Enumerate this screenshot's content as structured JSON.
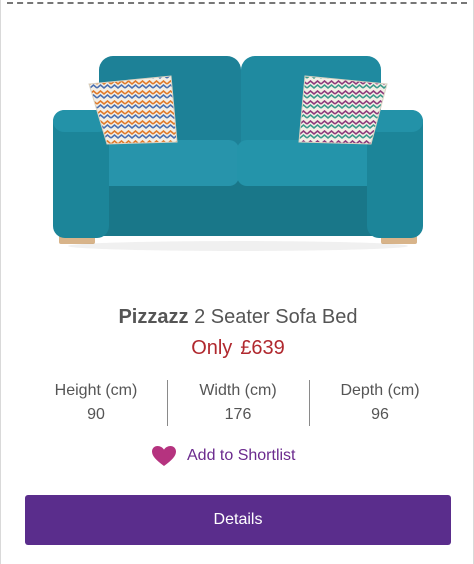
{
  "product": {
    "brand": "Pizzazz",
    "name": "2 Seater Sofa Bed",
    "price_prefix": "Only",
    "price": "£639"
  },
  "dimensions": [
    {
      "label": "Height (cm)",
      "value": "90"
    },
    {
      "label": "Width (cm)",
      "value": "176"
    },
    {
      "label": "Depth (cm)",
      "value": "96"
    }
  ],
  "shortlist": {
    "label": "Add to Shortlist",
    "icon": "heart-icon"
  },
  "details_button": {
    "label": "Details"
  },
  "colors": {
    "sofa": "#1f8aa0",
    "price": "#b0282e",
    "button": "#5a2d8c",
    "heart": "#b5337f"
  }
}
